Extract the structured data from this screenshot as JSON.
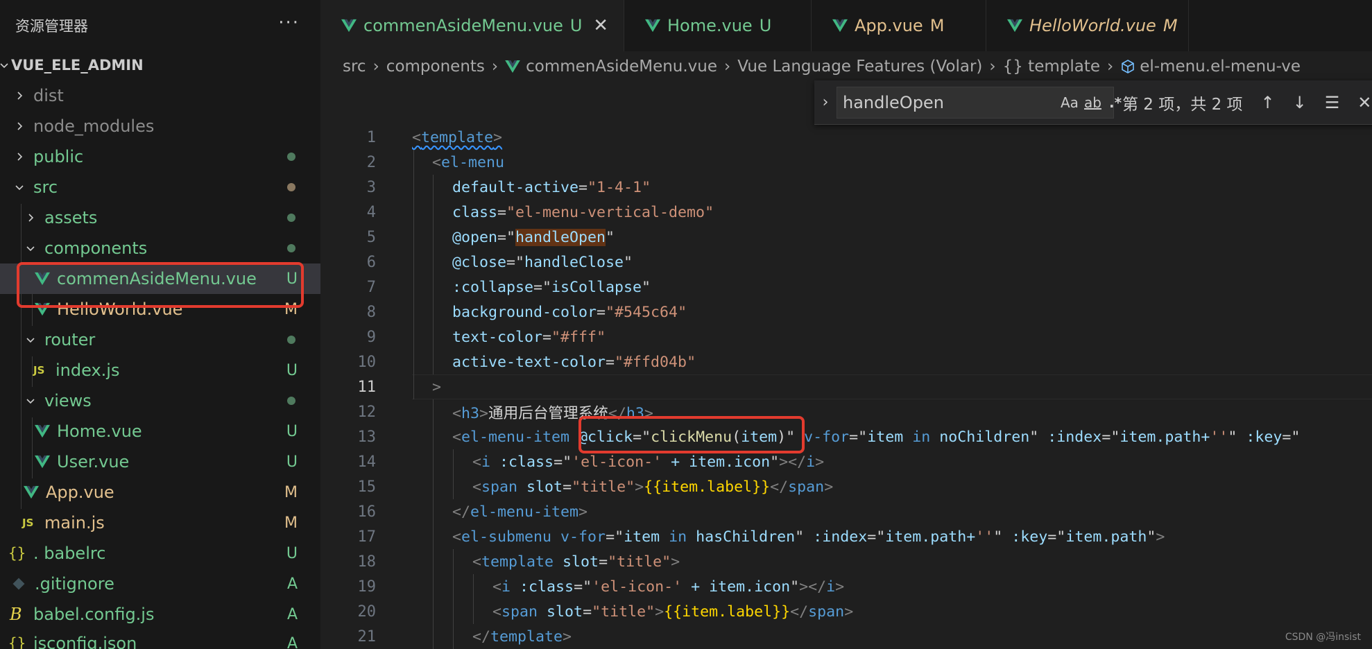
{
  "sidebar": {
    "title": "资源管理器",
    "more": "···",
    "tree": [
      {
        "label": "VUE_ELE_ADMIN",
        "status": "",
        "color": "#cccccc"
      },
      {
        "label": "dist",
        "status": "",
        "color": "#8c8c8c"
      },
      {
        "label": "node_modules",
        "status": "",
        "color": "#8c8c8c"
      },
      {
        "label": "public",
        "status": "",
        "color": "#73c991"
      },
      {
        "label": "src",
        "status": "",
        "color": "#73c991"
      },
      {
        "label": "assets",
        "status": "",
        "color": "#73c991"
      },
      {
        "label": "components",
        "status": "",
        "color": "#73c991"
      },
      {
        "label": "commenAsideMenu.vue",
        "status": "U",
        "color": "#73c991"
      },
      {
        "label": "HelloWorld.vue",
        "status": "M",
        "color": "#e2c08d"
      },
      {
        "label": "router",
        "status": "",
        "color": "#73c991"
      },
      {
        "label": "index.js",
        "status": "U",
        "color": "#73c991"
      },
      {
        "label": "views",
        "status": "",
        "color": "#73c991"
      },
      {
        "label": "Home.vue",
        "status": "U",
        "color": "#73c991"
      },
      {
        "label": "User.vue",
        "status": "U",
        "color": "#73c991"
      },
      {
        "label": "App.vue",
        "status": "M",
        "color": "#e2c08d"
      },
      {
        "label": "main.js",
        "status": "M",
        "color": "#e2c08d"
      },
      {
        "label": ". babelrc",
        "status": "U",
        "color": "#73c991"
      },
      {
        "label": ".gitignore",
        "status": "A",
        "color": "#73c991"
      },
      {
        "label": "babel.config.js",
        "status": "A",
        "color": "#73c991"
      },
      {
        "label": "jsconfig.json",
        "status": "A",
        "color": "#73c991"
      }
    ]
  },
  "tabs": [
    {
      "label": "commenAsideMenu.vue",
      "status": "U",
      "close": "✕"
    },
    {
      "label": "Home.vue",
      "status": "U"
    },
    {
      "label": "App.vue",
      "status": "M"
    },
    {
      "label": "HelloWorld.vue",
      "status": "M"
    }
  ],
  "breadcrumbs": [
    "src",
    "components",
    "commenAsideMenu.vue",
    "Vue Language Features (Volar)",
    "{} template",
    "el-menu.el-menu-ve"
  ],
  "find": {
    "query": "handleOpen",
    "opt_case": "Aa",
    "opt_word": "ab",
    "opt_regex": ".*",
    "result": "第 2 项，共 2 项",
    "up": "↑",
    "down": "↓",
    "menu": "☰",
    "close": "✕"
  },
  "code": {
    "line_numbers": [
      "1",
      "2",
      "3",
      "4",
      "5",
      "6",
      "7",
      "8",
      "9",
      "10",
      "11",
      "12",
      "13",
      "14",
      "15",
      "16",
      "17",
      "18",
      "19",
      "20",
      "21"
    ],
    "l1_tag": "template",
    "l2_tag": "el-menu",
    "l3_attr": "default-active",
    "l3_val": "1-4-1",
    "l4_attr": "class",
    "l4_val": "el-menu-vertical-demo",
    "l5_attr": "@open",
    "l5_val": "handleOpen",
    "l6_attr": "@close",
    "l6_val": "handleClose",
    "l7_attr": ":collapse",
    "l7_val": "isCollapse",
    "l8_attr": "background-color",
    "l8_val": "#545c64",
    "l9_attr": "text-color",
    "l9_val": "#fff",
    "l10_attr": "active-text-color",
    "l10_val": "#ffd04b",
    "l11_text": ">",
    "l12_tag": "h3",
    "l12_text": "通用后台管理系统",
    "l13_tag": "el-menu-item",
    "l13_click_attr": "@click",
    "l13_click_val": "clickMenu(item)",
    "l13_vfor_attr": "v-for",
    "l13_vfor_item": "item",
    "l13_vfor_in": "in",
    "l13_vfor_src": "noChildren",
    "l13_index_attr": ":index",
    "l13_index_val": "item.path+",
    "l13_index_str": "''",
    "l13_key_attr": ":key",
    "l14_tag": "i",
    "l14_attr": ":class",
    "l14_str": "'el-icon-'",
    "l14_rest": " + item.icon",
    "l15_tag": "span",
    "l15_attr": "slot",
    "l15_val": "title",
    "l15_must": "{{item.label}}",
    "l16_tag": "el-menu-item",
    "l17_tag": "el-submenu",
    "l17_vfor_attr": "v-for",
    "l17_vfor_item": "item",
    "l17_vfor_in": "in",
    "l17_vfor_src": "hasChildren",
    "l17_index_attr": ":index",
    "l17_index_val": "item.path+",
    "l17_index_str": "''",
    "l17_key_attr": ":key",
    "l17_key_val": "item.path",
    "l18_tag": "template",
    "l18_attr": "slot",
    "l18_val": "title",
    "l19_tag": "i",
    "l19_attr": ":class",
    "l19_str": "'el-icon-'",
    "l19_rest": " + item.icon",
    "l20_tag": "span",
    "l20_attr": "slot",
    "l20_val": "title",
    "l20_must": "{{item.label}}",
    "l21_tag": "template"
  },
  "watermark": "CSDN @冯insist",
  "colors": {
    "untracked": "#73c991",
    "modified": "#e2c08d",
    "vue_logo": "#41b883",
    "highlight_box": "#e23b2e"
  }
}
